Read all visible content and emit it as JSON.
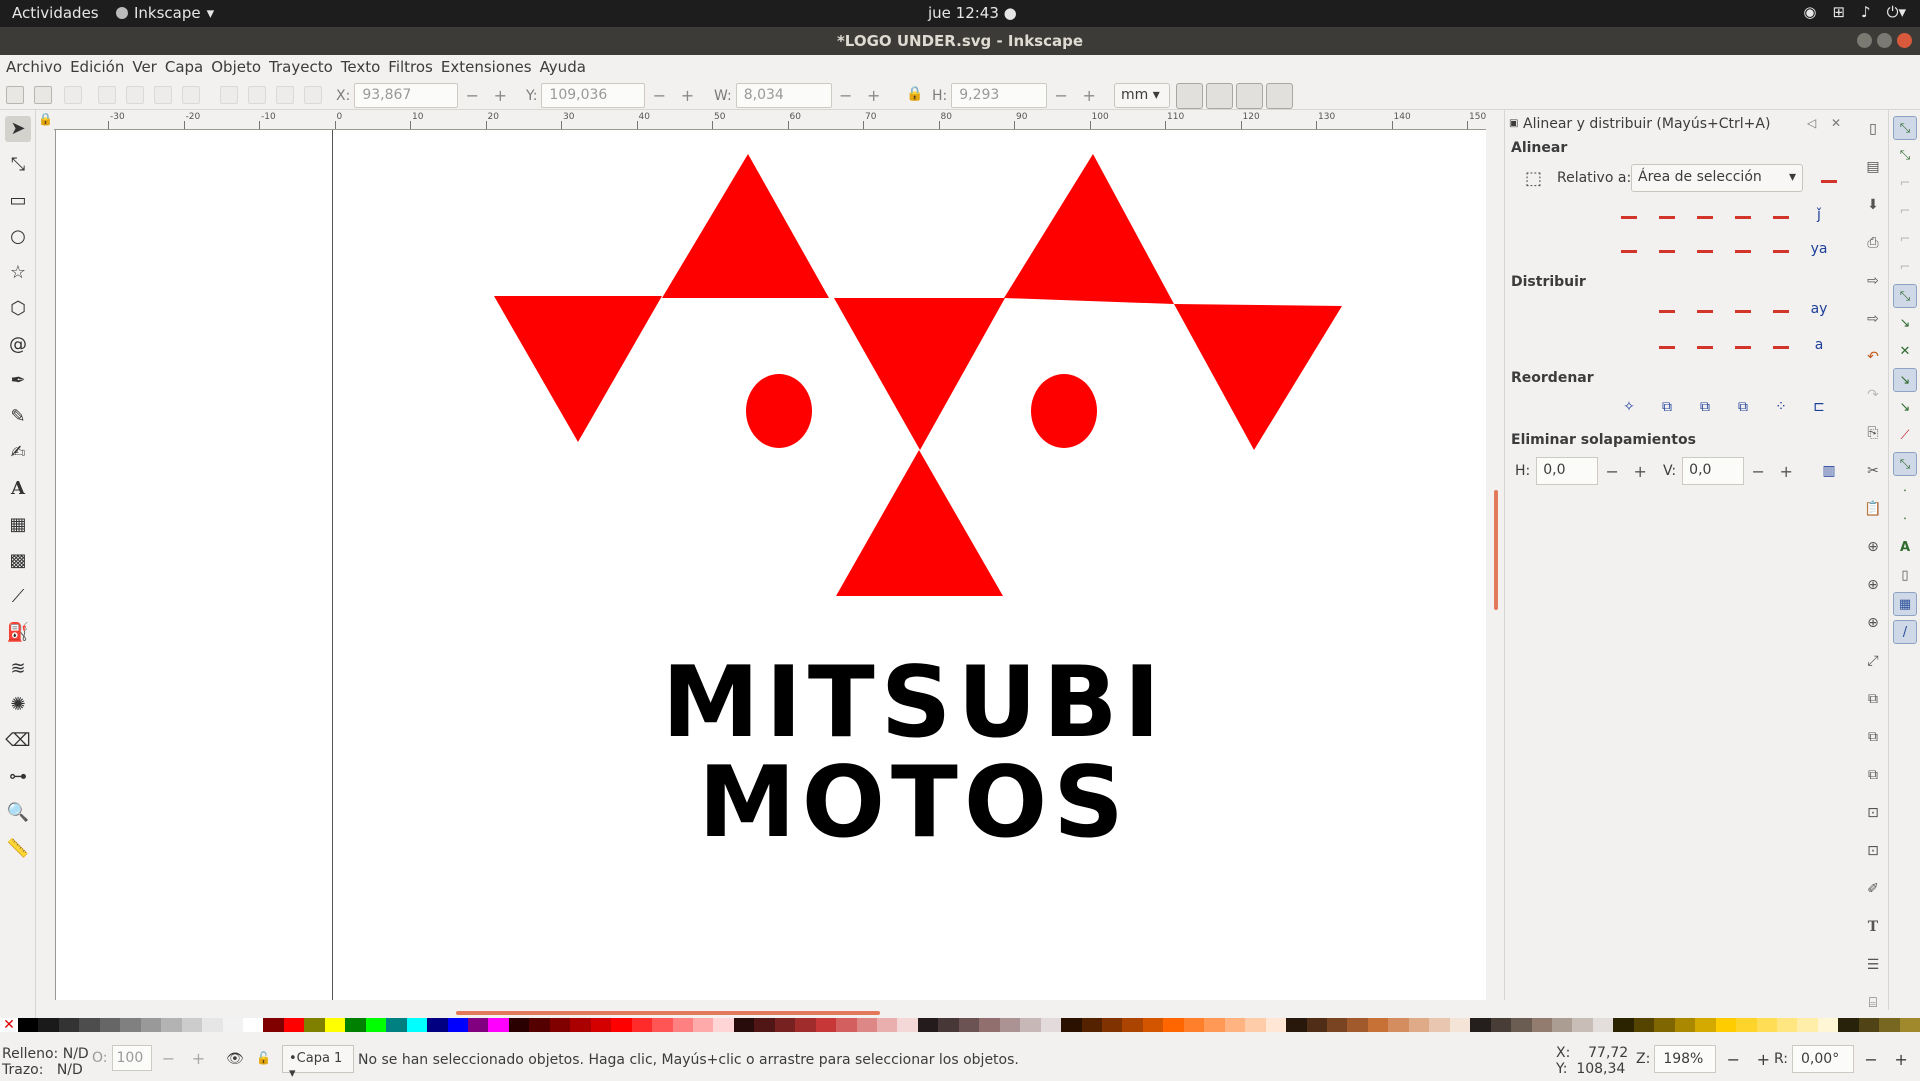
{
  "topbar": {
    "activities": "Actividades",
    "app_name": "Inkscape",
    "clock": "jue 12:43",
    "tray_icons": [
      "steam-icon",
      "network-icon",
      "volume-icon",
      "power-icon"
    ]
  },
  "window": {
    "title": "*LOGO UNDER.svg - Inkscape"
  },
  "menubar": [
    "Archivo",
    "Edición",
    "Ver",
    "Capa",
    "Objeto",
    "Trayecto",
    "Texto",
    "Filtros",
    "Extensiones",
    "Ayuda"
  ],
  "toolctl": {
    "x_label": "X:",
    "x_value": "93,867",
    "y_label": "Y:",
    "y_value": "109,036",
    "w_label": "W:",
    "w_value": "8,034",
    "h_label": "H:",
    "h_value": "9,293",
    "unit": "mm"
  },
  "ruler": {
    "h_ticks": [
      "-30",
      "-20",
      "-10",
      "0",
      "10",
      "20",
      "30",
      "40",
      "50",
      "60",
      "70",
      "80",
      "90",
      "100",
      "110",
      "120",
      "130",
      "140",
      "150"
    ]
  },
  "logo": {
    "line1": "MITSUBI",
    "line2": "MOTOS",
    "color": "#ff0000"
  },
  "dock": {
    "title": "Alinear y distribuir (Mayús+Ctrl+A)",
    "align_section": "Alinear",
    "relative_label": "Relativo a:",
    "relative_value": "Área de selección",
    "distribute_section": "Distribuir",
    "reorder_section": "Reordenar",
    "overlap_section": "Eliminar solapamientos",
    "h_label": "H:",
    "h_value": "0,0",
    "v_label": "V:",
    "v_value": "0,0"
  },
  "statusbar": {
    "fill_label": "Relleno:",
    "fill_value": "N/D",
    "stroke_label": "Trazo:",
    "stroke_value": "N/D",
    "opacity_label": "O:",
    "opacity_value": "100",
    "layer": "•Capa 1",
    "message": "No se han seleccionado objetos. Haga clic, Mayús+clic o arrastre para seleccionar los objetos.",
    "x_label": "X:",
    "x_value": "77,72",
    "y_label": "Y:",
    "y_value": "108,34",
    "zoom_label": "Z:",
    "zoom_value": "198%",
    "rot_label": "R:",
    "rot_value": "0,00°"
  },
  "palette": [
    "#000000",
    "#1a1a1a",
    "#333333",
    "#4d4d4d",
    "#666666",
    "#808080",
    "#999999",
    "#b3b3b3",
    "#cccccc",
    "#e6e6e6",
    "#f2f2f2",
    "#ffffff",
    "#800000",
    "#ff0000",
    "#808000",
    "#ffff00",
    "#008000",
    "#00ff00",
    "#008080",
    "#00ffff",
    "#000080",
    "#0000ff",
    "#800080",
    "#ff00ff",
    "#2b0000",
    "#550000",
    "#800000",
    "#aa0000",
    "#d40000",
    "#ff0000",
    "#ff2a2a",
    "#ff5555",
    "#ff8080",
    "#ffaaaa",
    "#ffd5d5",
    "#280b0b",
    "#501616",
    "#782121",
    "#a02c2c",
    "#c83737",
    "#d35f5f",
    "#de8787",
    "#e9afaf",
    "#f4d7d7",
    "#241c1c",
    "#483737",
    "#6c5353",
    "#916f6f",
    "#ac9393",
    "#c8b7b7",
    "#e3dbdb",
    "#2b1100",
    "#552200",
    "#803300",
    "#aa4400",
    "#d45500",
    "#ff6600",
    "#ff7f2a",
    "#ff9955",
    "#ffb380",
    "#ffccaa",
    "#ffe6d5",
    "#28170b",
    "#502d16",
    "#784421",
    "#a05a2c",
    "#c87137",
    "#d38d5f",
    "#deaa87",
    "#e9c6af",
    "#f4e3d7",
    "#241f1c",
    "#483e37",
    "#6c5d53",
    "#917c6f",
    "#ac9d93",
    "#c8beb7",
    "#e3dedb",
    "#2b2200",
    "#554400",
    "#806600",
    "#aa8800",
    "#d4aa00",
    "#ffcc00",
    "#ffd42a",
    "#ffdd55",
    "#ffe680",
    "#ffeeaa",
    "#fff6d5",
    "#28220b",
    "#504416",
    "#786721",
    "#a0892c"
  ]
}
